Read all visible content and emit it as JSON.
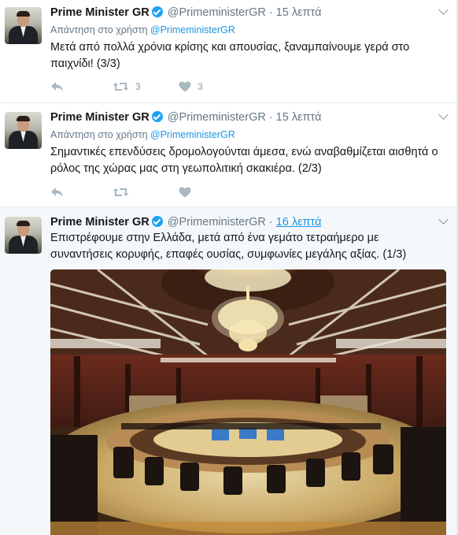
{
  "author": {
    "name": "Prime Minister GR",
    "handle": "@PrimeministerGR"
  },
  "tweets": [
    {
      "time": "15 λεπτά",
      "reply_prefix": "Απάντηση στο χρήστη",
      "reply_to": "@PrimeministerGR",
      "text": "Μετά από πολλά χρόνια κρίσης και απουσίας, ξαναμπαίνουμε γερά στο παιχνίδι! (3/3)",
      "retweets": "3",
      "likes": "3"
    },
    {
      "time": "15 λεπτά",
      "reply_prefix": "Απάντηση στο χρήστη",
      "reply_to": "@PrimeministerGR",
      "text": "Σημαντικές επενδύσεις δρομολογούνται άμεσα, ενώ αναβαθμίζεται αισθητά ο ρόλος της χώρας μας στη γεωπολιτική σκακιέρα. (2/3)",
      "retweets": "",
      "likes": ""
    },
    {
      "time": "16 λεπτά",
      "text": "Επιστρέφουμε στην Ελλάδα, μετά από ένα γεμάτο τετραήμερο με συναντήσεις κορυφής, επαφές ουσίας, συμφωνίες μεγάλης αξίας. (1/3)"
    }
  ],
  "icons": {
    "reply": "reply-icon",
    "retweet": "retweet-icon",
    "like": "heart-icon",
    "more": "chevron-down-icon",
    "verified": "verified-badge-icon"
  },
  "colors": {
    "link": "#1b95e0",
    "verified": "#1da1f2",
    "muted": "#657786",
    "icon": "#aab8c2"
  }
}
